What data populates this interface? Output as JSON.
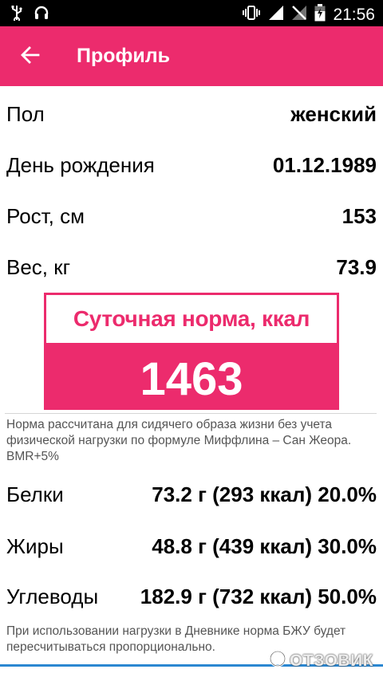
{
  "status_bar": {
    "time": "21:56",
    "icons_left": [
      "usb-icon",
      "headset-icon"
    ],
    "icons_right": [
      "vibrate-icon",
      "signal-icon",
      "no-signal-icon",
      "battery-charging-icon"
    ]
  },
  "appbar": {
    "title": "Профиль",
    "back_icon": "arrow-left-icon",
    "color": "#ec2b6d"
  },
  "profile": {
    "sex_label": "Пол",
    "sex_value": "женский",
    "birthday_label": "День рождения",
    "birthday_value": "01.12.1989",
    "height_label": "Рост, см",
    "height_value": "153",
    "weight_label": "Вес, кг",
    "weight_value": "73.9"
  },
  "norm": {
    "title": "Суточная норма, ккал",
    "value": "1463"
  },
  "note1": "Норма рассчитана для сидячего образа жизни без учета физической нагрузки по формуле Миффлина – Сан Жеора. BMR+5%",
  "macros": [
    {
      "label": "Белки",
      "value": "73.2 г (293 ккал) 20.0%"
    },
    {
      "label": "Жиры",
      "value": "48.8 г (439 ккал) 30.0%"
    },
    {
      "label": "Углеводы",
      "value": "182.9 г (732 ккал) 50.0%"
    }
  ],
  "note2": "При использовании нагрузки в Дневнике норма БЖУ будет пересчитываться пропорционально.",
  "watermark": "ОТЗОВИК"
}
